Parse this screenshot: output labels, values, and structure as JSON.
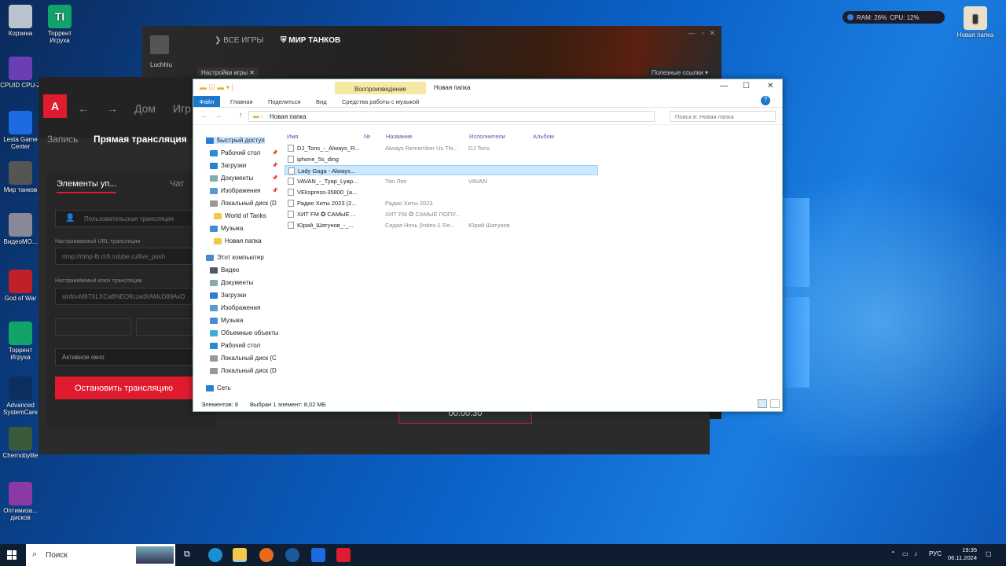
{
  "desktop": {
    "icons_left": [
      {
        "label": "Корзина",
        "color": "#b9c4cf",
        "glyph": "trash-icon"
      },
      {
        "label": "CPUID CPU-Z",
        "color": "#6a3fb5",
        "glyph": "cpu-z-icon"
      },
      {
        "label": "Lesta Game Center",
        "color": "#1e6ae0",
        "glyph": "lesta-icon"
      },
      {
        "label": "Мир танков",
        "color": "#555",
        "glyph": "tank-icon"
      },
      {
        "label": "ВидеоМО...",
        "color": "#889",
        "glyph": "film-icon"
      },
      {
        "label": "God of War",
        "color": "#c02028",
        "glyph": "gow-icon"
      },
      {
        "label": "Торрент Игруха",
        "color": "#12a36a",
        "glyph": "torrent-icon"
      },
      {
        "label": "Advanced SystemCare",
        "color": "#0b3060",
        "glyph": "asc-icon"
      },
      {
        "label": "Chernobylite",
        "color": "#3b5a3b",
        "glyph": "game-icon"
      },
      {
        "label": "Оптимиза... дисков",
        "color": "#8a3aa6",
        "glyph": "defrag-icon"
      }
    ],
    "icon_torrent_top": "Торрент Игруха",
    "icon_right": "Новая папка",
    "sysmon": {
      "ram": "RAM: 26%",
      "cpu": "CPU: 12%"
    }
  },
  "wot": {
    "user": "Luchhiu",
    "all_games": "ВСЕ ИГРЫ",
    "current": "МИР ТАНКОВ",
    "settings": "Настройки игры",
    "links": "Полезные ссылки"
  },
  "amd": {
    "logo": "A",
    "nav": {
      "home": "Дом",
      "games": "Игр"
    },
    "tabs": {
      "record": "Запись",
      "stream": "Прямая трансляция"
    },
    "subtabs": {
      "elements": "Элементы уп...",
      "chat": "Чат"
    },
    "custom_stream": "Пользовательская трансляция",
    "url_label": "Настраиваемый URL трансляции",
    "url_value": "rtmp://rtmp-lb.m9.rutube.ru/live_push",
    "key_label": "Настраиваемый ключ трансляции",
    "key_value": "sinfo=M67XLXCaBNEO9czwlXAMcD89AxD",
    "active_window": "Активное окно",
    "stop": "Остановить трансляцию",
    "timer": "00:00:30"
  },
  "explorer": {
    "context_tab": "Воспроизведение",
    "title": "Новая папка",
    "ribbon": {
      "file": "Файл",
      "home": "Главная",
      "share": "Поделиться",
      "view": "Вид",
      "music": "Средства работы с музыкой"
    },
    "path": "Новая папка",
    "search_placeholder": "Поиск в: Новая папка",
    "columns": {
      "name": "Имя",
      "num": "№",
      "title": "Название",
      "artist": "Исполнители",
      "album": "Альбом"
    },
    "nav": [
      {
        "label": "Быстрый доступ",
        "color": "#2a7fd4",
        "pin": ""
      },
      {
        "label": "Рабочий стол",
        "color": "#2a8ad4",
        "pin": "📌"
      },
      {
        "label": "Загрузки",
        "color": "#2a7fd4",
        "pin": "📌"
      },
      {
        "label": "Документы",
        "color": "#8aa",
        "pin": "📌"
      },
      {
        "label": "Изображения",
        "color": "#5a9ad4",
        "pin": "📌"
      },
      {
        "label": "Локальный диск (D",
        "color": "#999",
        "pin": ""
      },
      {
        "label": "World of Tanks",
        "color": "#f2c94c",
        "pin": ""
      },
      {
        "label": "Музыка",
        "color": "#4a8ad4",
        "pin": ""
      },
      {
        "label": "Новая папка",
        "color": "#f2c94c",
        "pin": ""
      },
      {
        "label": "Этот компьютер",
        "color": "#4a8ad4",
        "pin": ""
      },
      {
        "label": "Видео",
        "color": "#556",
        "pin": ""
      },
      {
        "label": "Документы",
        "color": "#8aa",
        "pin": ""
      },
      {
        "label": "Загрузки",
        "color": "#2a7fd4",
        "pin": ""
      },
      {
        "label": "Изображения",
        "color": "#5a9ad4",
        "pin": ""
      },
      {
        "label": "Музыка",
        "color": "#4a8ad4",
        "pin": ""
      },
      {
        "label": "Объемные объекты",
        "color": "#3ab0d0",
        "pin": ""
      },
      {
        "label": "Рабочий стол",
        "color": "#2a8ad4",
        "pin": ""
      },
      {
        "label": "Локальный диск (C",
        "color": "#999",
        "pin": ""
      },
      {
        "label": "Локальный диск (D",
        "color": "#999",
        "pin": ""
      },
      {
        "label": "Сеть",
        "color": "#2a7fd4",
        "pin": ""
      }
    ],
    "files": [
      {
        "name": "DJ_Tons_-_Always_R...",
        "title": "Always Remember Us Thi...",
        "artist": "DJ Tons"
      },
      {
        "name": "iphone_5s_ding",
        "title": "",
        "artist": ""
      },
      {
        "name": "Lady Gaga - Always...",
        "title": "",
        "artist": ""
      },
      {
        "name": "VAVAN_-_Tyap_Lyap...",
        "title": "Тяп Ляп",
        "artist": "VAVAN"
      },
      {
        "name": "VEkspress-35800_(a...",
        "title": "",
        "artist": ""
      },
      {
        "name": "Радио Хиты 2023 (2...",
        "title": "Радио Хиты 2023",
        "artist": ""
      },
      {
        "name": "ХИТ FM ✪ САМЫЕ ...",
        "title": "ХИТ FM ✪ САМЫЕ ПОПУ...",
        "artist": ""
      },
      {
        "name": "Юрий_Шатунов_-_...",
        "title": "Седая Ночь (Index-1 Re...",
        "artist": "Юрий Шатунов"
      }
    ],
    "selected_index": 2,
    "status": {
      "count": "Элементов: 8",
      "selected": "Выбран 1 элемент: 8,02 МБ"
    }
  },
  "taskbar": {
    "search": "Поиск",
    "lang": "РУС",
    "time": "19:35",
    "date": "06.11.2024"
  }
}
